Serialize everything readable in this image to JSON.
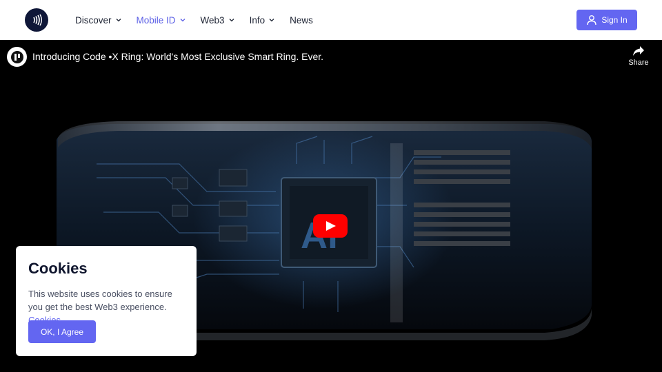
{
  "nav": {
    "items": [
      {
        "label": "Discover",
        "dropdown": true
      },
      {
        "label": "Mobile ID",
        "dropdown": true,
        "active": true
      },
      {
        "label": "Web3",
        "dropdown": true
      },
      {
        "label": "Info",
        "dropdown": true
      },
      {
        "label": "News",
        "dropdown": false
      }
    ],
    "signin_label": "Sign In"
  },
  "video": {
    "title": "Introducing Code •X Ring: World's Most Exclusive Smart Ring. Ever.",
    "share_label": "Share",
    "chip_text": "Ai"
  },
  "cookie": {
    "title": "Cookies",
    "text": "This website uses cookies to ensure you get the best Web3 experience.",
    "link_label": "Cookies",
    "button_label": "OK, I Agree"
  },
  "colors": {
    "accent": "#6366f1",
    "logo_bg": "#0f1738",
    "youtube_red": "#ff0000"
  }
}
